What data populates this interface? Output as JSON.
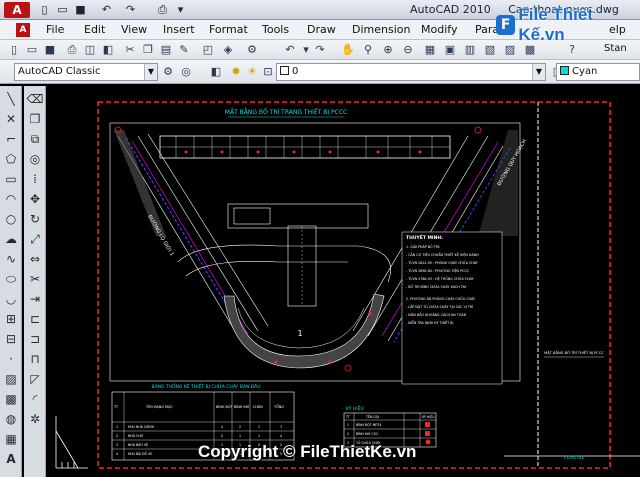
{
  "titlebar": {
    "app_title": "AutoCAD 2010",
    "file_name": "Cap thoat nuoc.dwg"
  },
  "watermark": {
    "logo_text": "File Thiết Kế",
    "logo_suffix": ".vn",
    "copyright": "Copyright © FileThietKe.vn"
  },
  "menu": {
    "items": [
      "File",
      "Edit",
      "View",
      "Insert",
      "Format",
      "Tools",
      "Draw",
      "Dimension",
      "Modify",
      "Param",
      "elp"
    ]
  },
  "toolbar1": {
    "workspace_label": "Stan"
  },
  "toolbar2": {
    "workspace": "AutoCAD Classic",
    "layer_value": "0",
    "color_value": "Cyan"
  },
  "colors": {
    "canvas": "#000000",
    "frame_red": "#ff2020",
    "line_white": "#ffffff",
    "accent_cyan": "#00e0e0",
    "accent_magenta": "#ff00ff",
    "accent_blue": "#4040ff"
  },
  "drawing": {
    "main_title": "MẶT BẰNG BỐ TRÍ TRANG THIẾT BỊ PCCC",
    "road_label": "ĐƯỜNG LỘ GIỚI 1",
    "road_label_right": "ĐƯỜNG QUY HOẠCH",
    "center_label": "1",
    "notes_title": "THUYẾT MINH:",
    "notes": [
      "1. GIẢI PHÁP BỐ TRÍ:",
      "- CĂN CỨ TIÊU CHUẨN THIẾT KẾ HIỆN HÀNH",
      "- TCVN 2622-95 : PHÒNG CHÁY CHỮA CHÁY",
      "- TCVN 3890-84 : PHƯƠNG TIỆN PCCC",
      "- TCVN 5760-93 : HỆ THỐNG CHỮA CHÁY",
      "- BỐ TRÍ BÌNH CHỮA CHÁY XÁCH TAY",
      "2. PHƯƠNG ÁN PHÒNG CHÁY CHỮA CHÁY",
      "- LẮP ĐẶT TỦ CHỮA CHÁY TẠI CÁC VỊ TRÍ",
      "- ĐẢM BẢO KHOẢNG CÁCH AN TOÀN",
      "- KIỂM TRA ĐỊNH KỲ THIẾT BỊ"
    ],
    "side_caption": "MẶT BẰNG BỐ TRÍ THIẾT BỊ PCCC",
    "sheet_number": "CCHC-01",
    "table_title": "BẢNG THỐNG KÊ THIẾT BỊ CHỮA CHÁY BAN ĐẦU",
    "table_headers": [
      "TT",
      "TÊN HẠNG MỤC",
      "BÌNH BỘT",
      "BÌNH KHÍ",
      "CHĂN",
      "TỔNG"
    ],
    "table_rows": [
      [
        "1",
        "KHU NHÀ CHÍNH",
        "4",
        "2",
        "1",
        "7"
      ],
      [
        "2",
        "NHÀ CHỜ",
        "2",
        "1",
        "1",
        "4"
      ],
      [
        "3",
        "NHÀ BẢO VỆ",
        "1",
        "1",
        "0",
        "2"
      ],
      [
        "4",
        "KHU BÃI ĐỖ XE",
        "3",
        "1",
        "1",
        "5"
      ]
    ],
    "legend_title": "KÝ HIỆU",
    "legend_headers": [
      "TT",
      "TÊN GỌI",
      "KÝ HIỆU"
    ],
    "legend_rows": [
      [
        "1",
        "BÌNH BỘT MFZ4",
        ""
      ],
      [
        "2",
        "BÌNH KHÍ CO2",
        ""
      ],
      [
        "3",
        "TỦ CHỮA CHÁY",
        ""
      ]
    ]
  }
}
